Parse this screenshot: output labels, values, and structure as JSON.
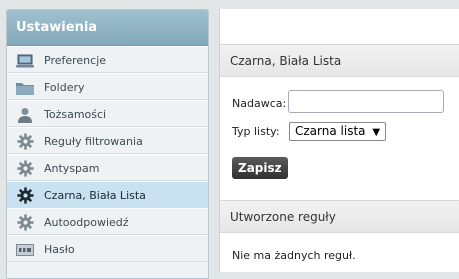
{
  "sidebar": {
    "title": "Ustawienia",
    "items": [
      {
        "label": "Preferencje",
        "icon": "laptop-icon"
      },
      {
        "label": "Foldery",
        "icon": "folder-icon"
      },
      {
        "label": "Tożsamości",
        "icon": "person-icon"
      },
      {
        "label": "Reguły filtrowania",
        "icon": "gear-icon"
      },
      {
        "label": "Antyspam",
        "icon": "gear-icon"
      },
      {
        "label": "Czarna, Biała Lista",
        "icon": "gear-icon",
        "selected": true
      },
      {
        "label": "Autoodpowiedź",
        "icon": "gear-icon"
      },
      {
        "label": "Hasło",
        "icon": "password-icon"
      }
    ]
  },
  "main": {
    "section_title": "Czarna, Biała Lista",
    "sender_label": "Nadawca:",
    "sender_value": "",
    "list_type_label": "Typ listy:",
    "list_type_selected": "Czarna lista",
    "save_label": "Zapisz",
    "rules_title": "Utworzone reguły",
    "no_rules_text": "Nie ma żadnych reguł."
  }
}
